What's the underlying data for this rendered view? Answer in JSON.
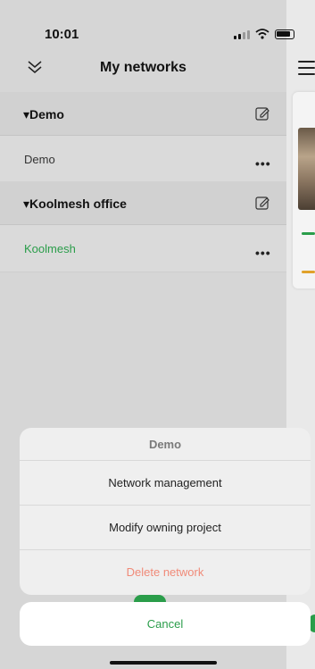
{
  "status": {
    "time": "10:01"
  },
  "header": {
    "title": "My networks"
  },
  "groups": [
    {
      "title": "▾Demo",
      "network": "Demo",
      "network_color": "#333333"
    },
    {
      "title": "▾Koolmesh office",
      "network": "Koolmesh",
      "network_color": "#2a9d4a"
    }
  ],
  "more_label": "•••",
  "sheet": {
    "title": "Demo",
    "items": [
      "Network management",
      "Modify owning project",
      "Delete network"
    ],
    "cancel": "Cancel"
  },
  "colors": {
    "accent": "#2a9d4a",
    "danger": "#f08a78",
    "warning": "#e0a12a"
  }
}
